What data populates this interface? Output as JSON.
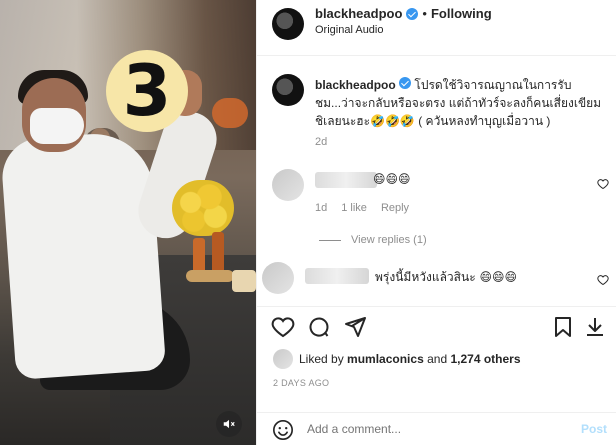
{
  "post": {
    "username": "blackheadpoo",
    "follow_separator": "•",
    "follow_label": "Following",
    "audio_label": "Original Audio",
    "badge_text": "3"
  },
  "caption": {
    "username": "blackheadpoo",
    "text": "โปรดใช้วิจารณญาณในการรับชม...ว่าจะกลับหรือจะตรง แต่ถ้าทัวร์จะลงก็คนเสี่ยงเขียมชิเลยนะฮะ🤣🤣🤣 ( ควันหลงทำบุญเมื่อวาน )",
    "time": "2d"
  },
  "comments": [
    {
      "text": "😄😄😄",
      "time": "1d",
      "likes": "1 like",
      "reply": "Reply",
      "view_replies": "View replies (1)"
    },
    {
      "text": "พรุ่งนี้มีหวังแล้วสินะ 😄😄😄"
    }
  ],
  "likes": {
    "prefix": "Liked by",
    "user": "mumlaconics",
    "joiner": "and",
    "others": "1,274 others"
  },
  "date": "2 DAYS AGO",
  "add_comment": {
    "placeholder": "Add a comment...",
    "post_label": "Post"
  },
  "icons": {
    "verified": "verified-badge-icon",
    "heart": "heart-icon",
    "comment": "comment-icon",
    "share": "share-icon",
    "save": "bookmark-icon",
    "download": "download-icon",
    "emoji": "emoji-icon",
    "mute": "muted-speaker-icon"
  },
  "colors": {
    "verified": "#3897f0",
    "post_button": "#b2dffc",
    "muted_text": "#8e8e8e"
  }
}
